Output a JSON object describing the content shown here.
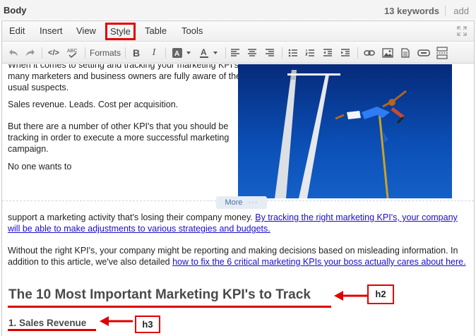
{
  "header": {
    "label": "Body",
    "keyword_count": "13 keywords",
    "add": "add"
  },
  "menubar": {
    "items": [
      "Edit",
      "Insert",
      "View",
      "Style",
      "Table",
      "Tools"
    ],
    "highlighted": "Style"
  },
  "toolbar": {
    "formats_label": "Formats",
    "bold": "B",
    "italic": "I",
    "icons": [
      "undo-icon",
      "redo-icon",
      "source-code-icon",
      "spellcheck-icon",
      "formats-dropdown",
      "bold-icon",
      "italic-icon",
      "background-color-icon",
      "text-color-icon",
      "align-left-icon",
      "align-center-icon",
      "align-right-icon",
      "bullet-list-icon",
      "numbered-list-icon",
      "outdent-icon",
      "indent-icon",
      "link-icon",
      "image-icon",
      "document-icon",
      "media-icon",
      "page-break-icon"
    ]
  },
  "content": {
    "p1": "When it comes to setting and tracking your marketing KPI's, many marketers and business owners are fully aware of the usual suspects.",
    "p2": "Sales revenue. Leads. Cost per acquisition.",
    "p3": "But there are a number of other KPI's that you should be tracking in order to execute a more successful marketing campaign.",
    "p4": "No one wants to",
    "more_label": "More",
    "p5_text": "support a marketing activity that's losing their company money.",
    "p5_link": "By tracking the right marketing KPI's, your company will be able to make adjustments to various strategies and budgets.",
    "p6_text": "Without the right KPI's, your company might be reporting and making decisions based on misleading information. In addition to this article, we've also detailed",
    "p6_link": "how to fix the 6 critical marketing KPIs your boss actually cares about here.",
    "h2": "The 10 Most Important Marketing KPI's to Track",
    "h3": "1. Sales Revenue"
  },
  "annotations": {
    "h2_label": "h2",
    "h3_label": "h3",
    "color": "#e00000"
  }
}
